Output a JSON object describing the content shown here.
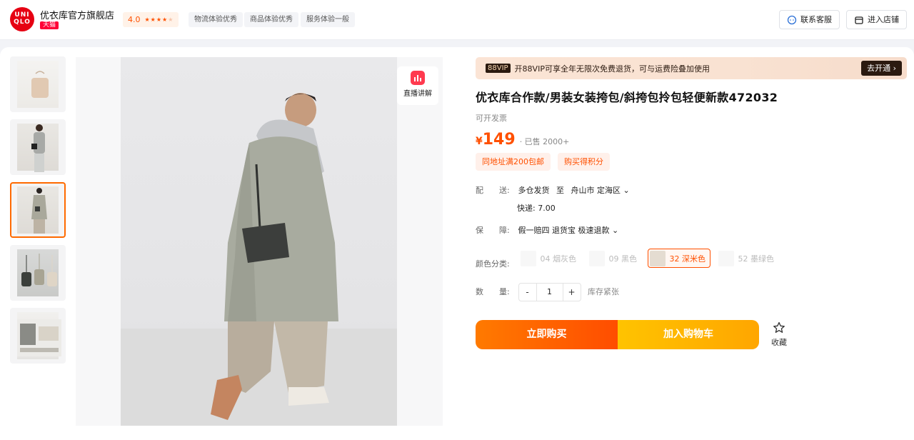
{
  "store": {
    "logo_lines": [
      "UNI",
      "QLO"
    ],
    "name": "优衣库官方旗舰店",
    "badge": "天猫",
    "rating": "4.0",
    "rating_stars": 4,
    "service_chips": [
      "物流体验优秀",
      "商品体验优秀",
      "服务体验一般"
    ],
    "contact_label": "联系客服",
    "enter_label": "进入店铺"
  },
  "gallery": {
    "thumbnail_count": 5,
    "active_index": 2,
    "live_label": "直播讲解"
  },
  "product": {
    "vip_tag": "88VIP",
    "vip_text": "开88VIP可享全年无限次免费退货，可与运费险叠加使用",
    "vip_action": "去开通",
    "title": "优衣库合作款/男装女装挎包/斜挎包拎包轻便新款472032",
    "invoice": "可开发票",
    "price_symbol": "¥",
    "price": "149",
    "sold": "· 已售 2000+",
    "promos": [
      "同地址满200包邮",
      "购买得积分"
    ],
    "delivery": {
      "label": "配　　送:",
      "from": "多仓发货",
      "to_word": "至",
      "destination": "舟山市 定海区",
      "shipping": "快递: 7.00"
    },
    "guarantee": {
      "label": "保　　障:",
      "items": "假一赔四 退货宝 极速退款"
    },
    "color": {
      "label": "颜色分类:",
      "options": [
        {
          "label": "04 烟灰色",
          "state": "disabled"
        },
        {
          "label": "09 黑色",
          "state": "disabled"
        },
        {
          "label": "32 深米色",
          "state": "selected"
        },
        {
          "label": "52 墨绿色",
          "state": "disabled"
        }
      ]
    },
    "quantity": {
      "label": "数　　量:",
      "minus": "-",
      "value": "1",
      "plus": "+",
      "stock": "库存紧张"
    },
    "buy_label": "立即购买",
    "cart_label": "加入购物车",
    "fav_label": "收藏"
  },
  "colors": {
    "accent": "#ff5000",
    "tmall_red": "#ff0036",
    "logo_red": "#e60012"
  }
}
